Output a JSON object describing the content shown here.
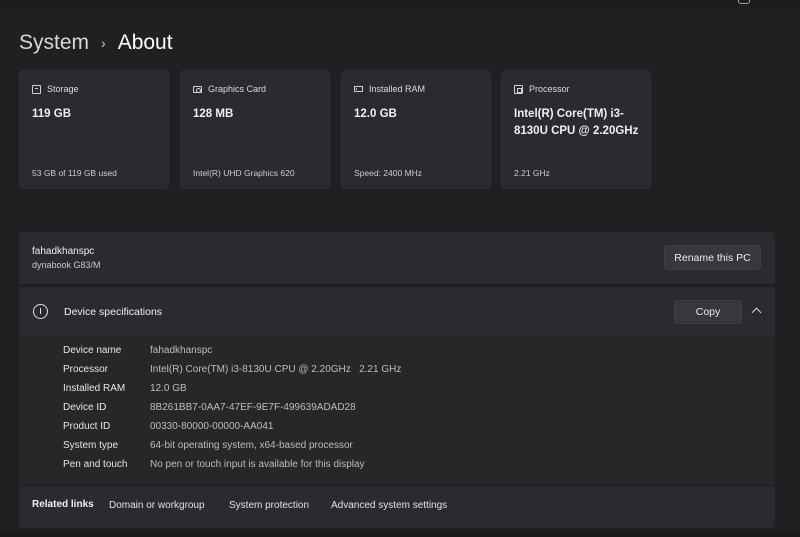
{
  "breadcrumb": {
    "parent": "System",
    "separator": "›",
    "current": "About"
  },
  "cards": [
    {
      "icon": "storage-icon",
      "title": "Storage",
      "value": "119 GB",
      "footer": "53 GB of 119 GB used"
    },
    {
      "icon": "graphics-card-icon",
      "title": "Graphics Card",
      "value": "128 MB",
      "footer": "Intel(R) UHD Graphics 620"
    },
    {
      "icon": "ram-icon",
      "title": "Installed RAM",
      "value": "12.0 GB",
      "footer": "Speed: 2400 MHz"
    },
    {
      "icon": "processor-icon",
      "title": "Processor",
      "value": "Intel(R) Core(TM) i3-8130U CPU @ 2.20GHz",
      "footer": "2.21 GHz"
    }
  ],
  "pc": {
    "name": "fahadkhanspc",
    "model": "dynabook G83/M",
    "rename_label": "Rename this PC"
  },
  "specs": {
    "title": "Device specifications",
    "copy_label": "Copy",
    "rows": [
      {
        "key": "Device name",
        "value": "fahadkhanspc"
      },
      {
        "key": "Processor",
        "value": "Intel(R) Core(TM) i3-8130U CPU @ 2.20GHz   2.21 GHz"
      },
      {
        "key": "Installed RAM",
        "value": "12.0 GB"
      },
      {
        "key": "Device ID",
        "value": "8B261BB7-0AA7-47EF-9E7F-499639ADAD28"
      },
      {
        "key": "Product ID",
        "value": "00330-80000-00000-AA041"
      },
      {
        "key": "System type",
        "value": "64-bit operating system, x64-based processor"
      },
      {
        "key": "Pen and touch",
        "value": "No pen or touch input is available for this display"
      }
    ]
  },
  "related": {
    "label": "Related links",
    "links": [
      "Domain or workgroup",
      "System protection",
      "Advanced system settings"
    ]
  }
}
